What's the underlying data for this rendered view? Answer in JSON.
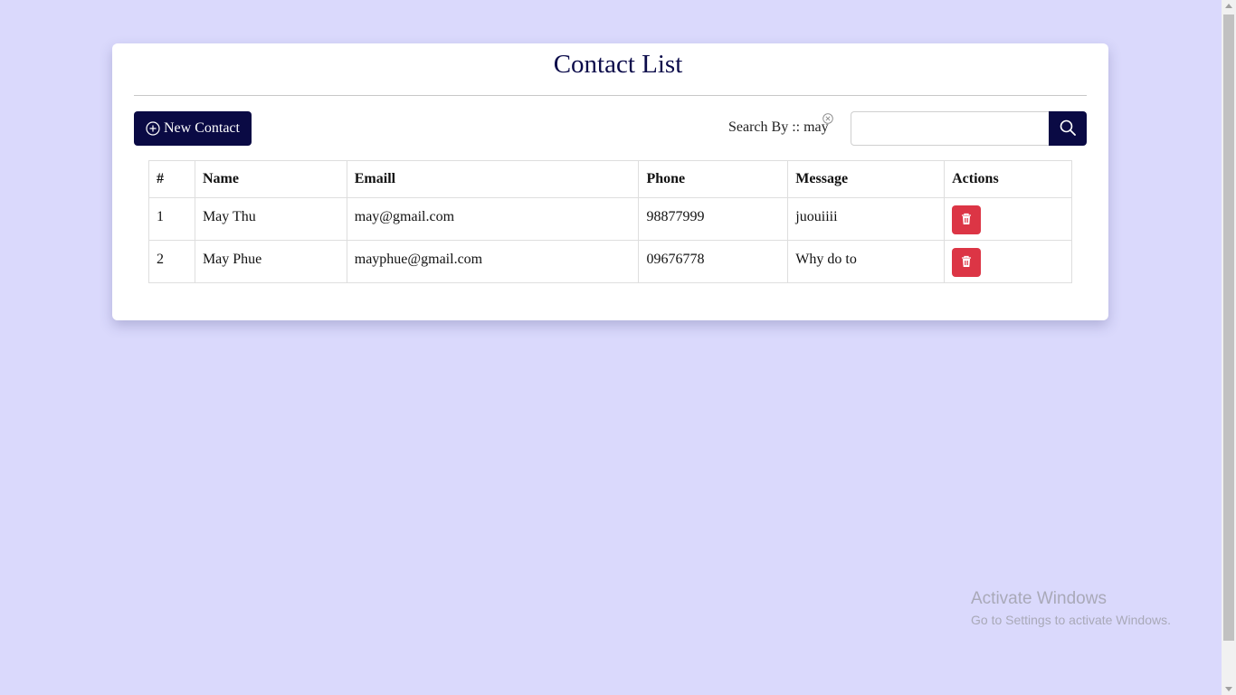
{
  "page": {
    "title": "Contact List"
  },
  "toolbar": {
    "new_contact_label": "New Contact",
    "search_label": "Search By :: may",
    "search_value": "",
    "search_placeholder": ""
  },
  "table": {
    "headers": [
      "#",
      "Name",
      "Emaill",
      "Phone",
      "Message",
      "Actions"
    ],
    "rows": [
      {
        "index": "1",
        "name": "May Thu",
        "email": "may@gmail.com",
        "phone": "98877999",
        "message": "juouiiii"
      },
      {
        "index": "2",
        "name": "May Phue",
        "email": "mayphue@gmail.com",
        "phone": "09676778",
        "message": "Why do to"
      }
    ]
  },
  "watermark": {
    "line1": "Activate Windows",
    "line2": "Go to Settings to activate Windows."
  },
  "colors": {
    "background": "#dad9fc",
    "primary": "#0a0a44",
    "danger": "#dc3545"
  },
  "icons": [
    "plus-circle-icon",
    "clear-icon",
    "search-icon",
    "trash-icon"
  ]
}
